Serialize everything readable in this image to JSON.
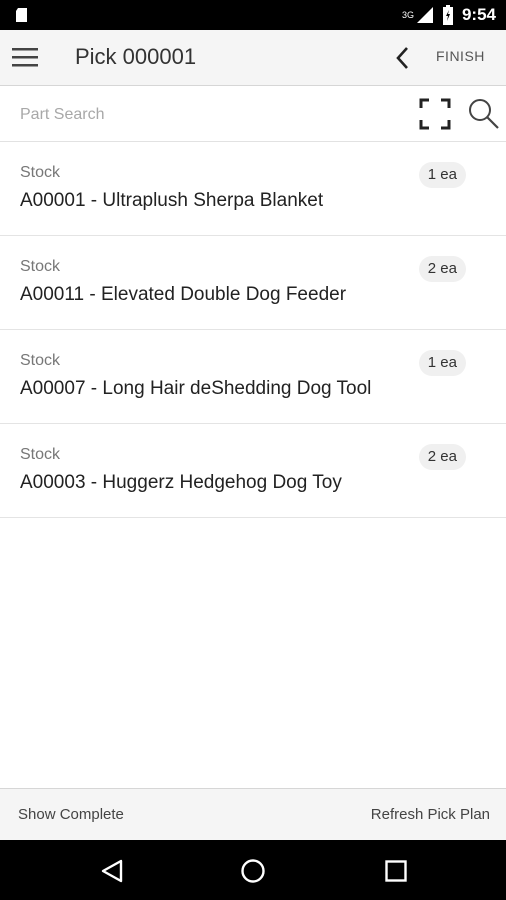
{
  "status_bar": {
    "time": "9:54",
    "network": "3G"
  },
  "header": {
    "title": "Pick 000001",
    "finish_label": "FINISH"
  },
  "search": {
    "placeholder": "Part Search"
  },
  "items": [
    {
      "type": "Stock",
      "title": "A00001 - Ultraplush Sherpa Blanket",
      "qty": "1 ea"
    },
    {
      "type": "Stock",
      "title": "A00011 - Elevated Double Dog Feeder",
      "qty": "2 ea"
    },
    {
      "type": "Stock",
      "title": "A00007 - Long Hair deShedding Dog Tool",
      "qty": "1 ea"
    },
    {
      "type": "Stock",
      "title": "A00003 - Huggerz Hedgehog Dog Toy",
      "qty": "2 ea"
    }
  ],
  "footer": {
    "show_complete": "Show Complete",
    "refresh": "Refresh Pick Plan"
  },
  "icons": {
    "menu": "menu-icon",
    "back": "chevron-left-icon",
    "scan": "scan-frame-icon",
    "search": "search-icon",
    "nav_back": "triangle-back-icon",
    "nav_home": "circle-home-icon",
    "nav_recents": "square-recents-icon"
  }
}
